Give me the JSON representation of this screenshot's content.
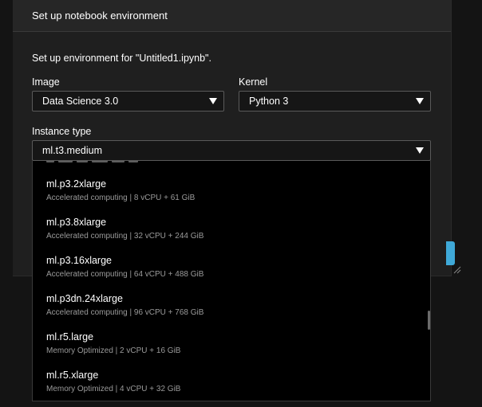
{
  "dialog": {
    "title": "Set up notebook environment",
    "lead": "Set up environment for \"Untitled1.ipynb\"."
  },
  "image": {
    "label": "Image",
    "value": "Data Science 3.0"
  },
  "kernel": {
    "label": "Kernel",
    "value": "Python 3"
  },
  "instance_type": {
    "label": "Instance type",
    "value": "ml.t3.medium",
    "options": [
      {
        "name": "ml.p3.2xlarge",
        "desc": "Accelerated computing | 8 vCPU + 61 GiB"
      },
      {
        "name": "ml.p3.8xlarge",
        "desc": "Accelerated computing | 32 vCPU + 244 GiB"
      },
      {
        "name": "ml.p3.16xlarge",
        "desc": "Accelerated computing | 64 vCPU + 488 GiB"
      },
      {
        "name": "ml.p3dn.24xlarge",
        "desc": "Accelerated computing | 96 vCPU + 768 GiB"
      },
      {
        "name": "ml.r5.large",
        "desc": "Memory Optimized | 2 vCPU + 16 GiB"
      },
      {
        "name": "ml.r5.xlarge",
        "desc": "Memory Optimized | 4 vCPU + 32 GiB"
      }
    ]
  },
  "colors": {
    "accent": "#3fa9d8",
    "dropdown_background": "#000000",
    "dialog_background": "#1f1f1f",
    "secondary_text": "#9a9a9a"
  },
  "icons": {
    "select_caret": "caret-down-icon",
    "resize": "resize-grip-icon"
  }
}
